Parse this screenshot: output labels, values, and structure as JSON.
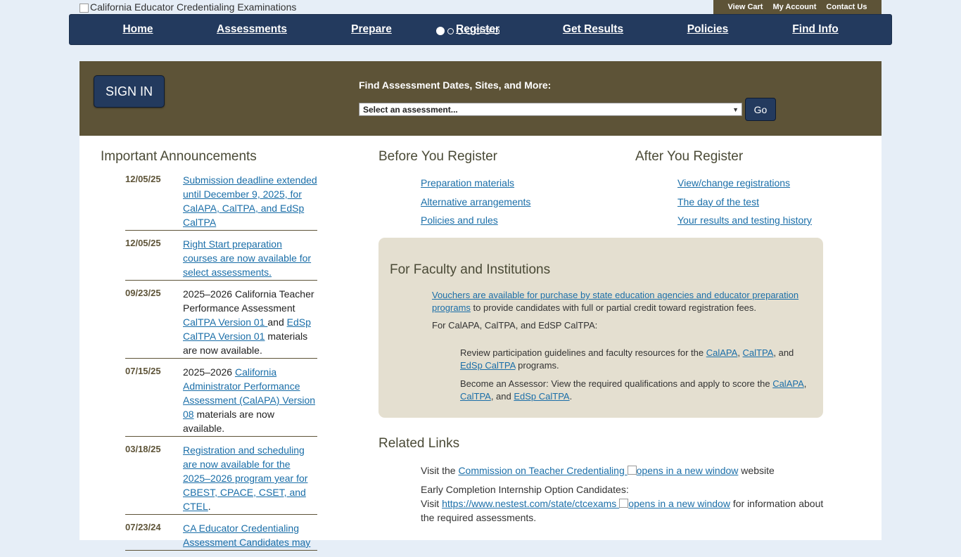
{
  "logo": {
    "alt_text": "California Educator Credentialing Examinations"
  },
  "utility": {
    "view_cart": "View Cart",
    "my_account": "My Account",
    "contact_us": "Contact Us"
  },
  "nav": [
    "Home",
    "Assessments",
    "Prepare",
    "Register",
    "Get Results",
    "Policies",
    "Find Info"
  ],
  "banner": {
    "sign_in": "SIGN IN",
    "find_label": "Find Assessment Dates, Sites, and More:",
    "select_value": "Select an assessment...",
    "go": "Go"
  },
  "announcements": {
    "heading": "Important Announcements",
    "items": [
      {
        "date": "12/05/25",
        "text": "Submission deadline extended until December 9, 2025, for CalAPA, CalTPA, and EdSp CalTPA"
      },
      {
        "date": "12/05/25",
        "text": "Right Start preparation courses are now available for select assessments."
      },
      {
        "date": "09/23/25",
        "pre": "2025–2026 California Teacher Performance Assessment ",
        "link1": "CalTPA Version 01 ",
        "mid": "and ",
        "link2": "EdSp CalTPA Version 01",
        "post": " materials are now available."
      },
      {
        "date": "07/15/25",
        "pre": "2025–2026 ",
        "link1": "California Administrator Performance Assessment (CalAPA) Version 08",
        "post": " materials are now available."
      },
      {
        "date": "03/18/25",
        "text": "Registration and scheduling are now available for the 2025–2026 program year for CBEST, CPACE, CSET, and CTEL",
        "post": "."
      },
      {
        "date": "07/23/24",
        "text": "CA Educator Credentialing Assessment Candidates may"
      }
    ]
  },
  "before": {
    "heading": "Before You Register",
    "links": [
      "Preparation materials",
      "Alternative arrangements",
      "Policies and rules"
    ]
  },
  "after": {
    "heading": "After You Register",
    "links": [
      "View/change registrations",
      "The day of the test",
      "Your results and testing history"
    ]
  },
  "faculty": {
    "heading": "For Faculty and Institutions",
    "voucher_link": "Vouchers are available for purchase by state education agencies and educator preparation programs",
    "voucher_post": " to provide candidates with full or partial credit toward registration fees.",
    "for_label": "For CalAPA, CalTPA, and EdSP CalTPA:",
    "review_pre": "Review participation guidelines and faculty resources for the ",
    "assessor_pre": "Become an Assessor: View the required qualifications and apply to score the ",
    "calapa": "CalAPA",
    "caltpa": "CalTPA",
    "edsp": "EdSp CalTPA",
    "comma": ", ",
    "comma_and": ", and ",
    "programs": " programs.",
    "period": "."
  },
  "related": {
    "heading": "Related Links",
    "visit_pre": "Visit the ",
    "ctc_link": "Commission on Teacher Credentialing ",
    "new_window_alt": "opens in a new window",
    "website": " website",
    "early": "Early Completion Internship Option Candidates:",
    "visit": "Visit ",
    "nes_link": "https://www.nestest.com/state/ctcexams ",
    "info_post": " for information about the required assessments."
  }
}
